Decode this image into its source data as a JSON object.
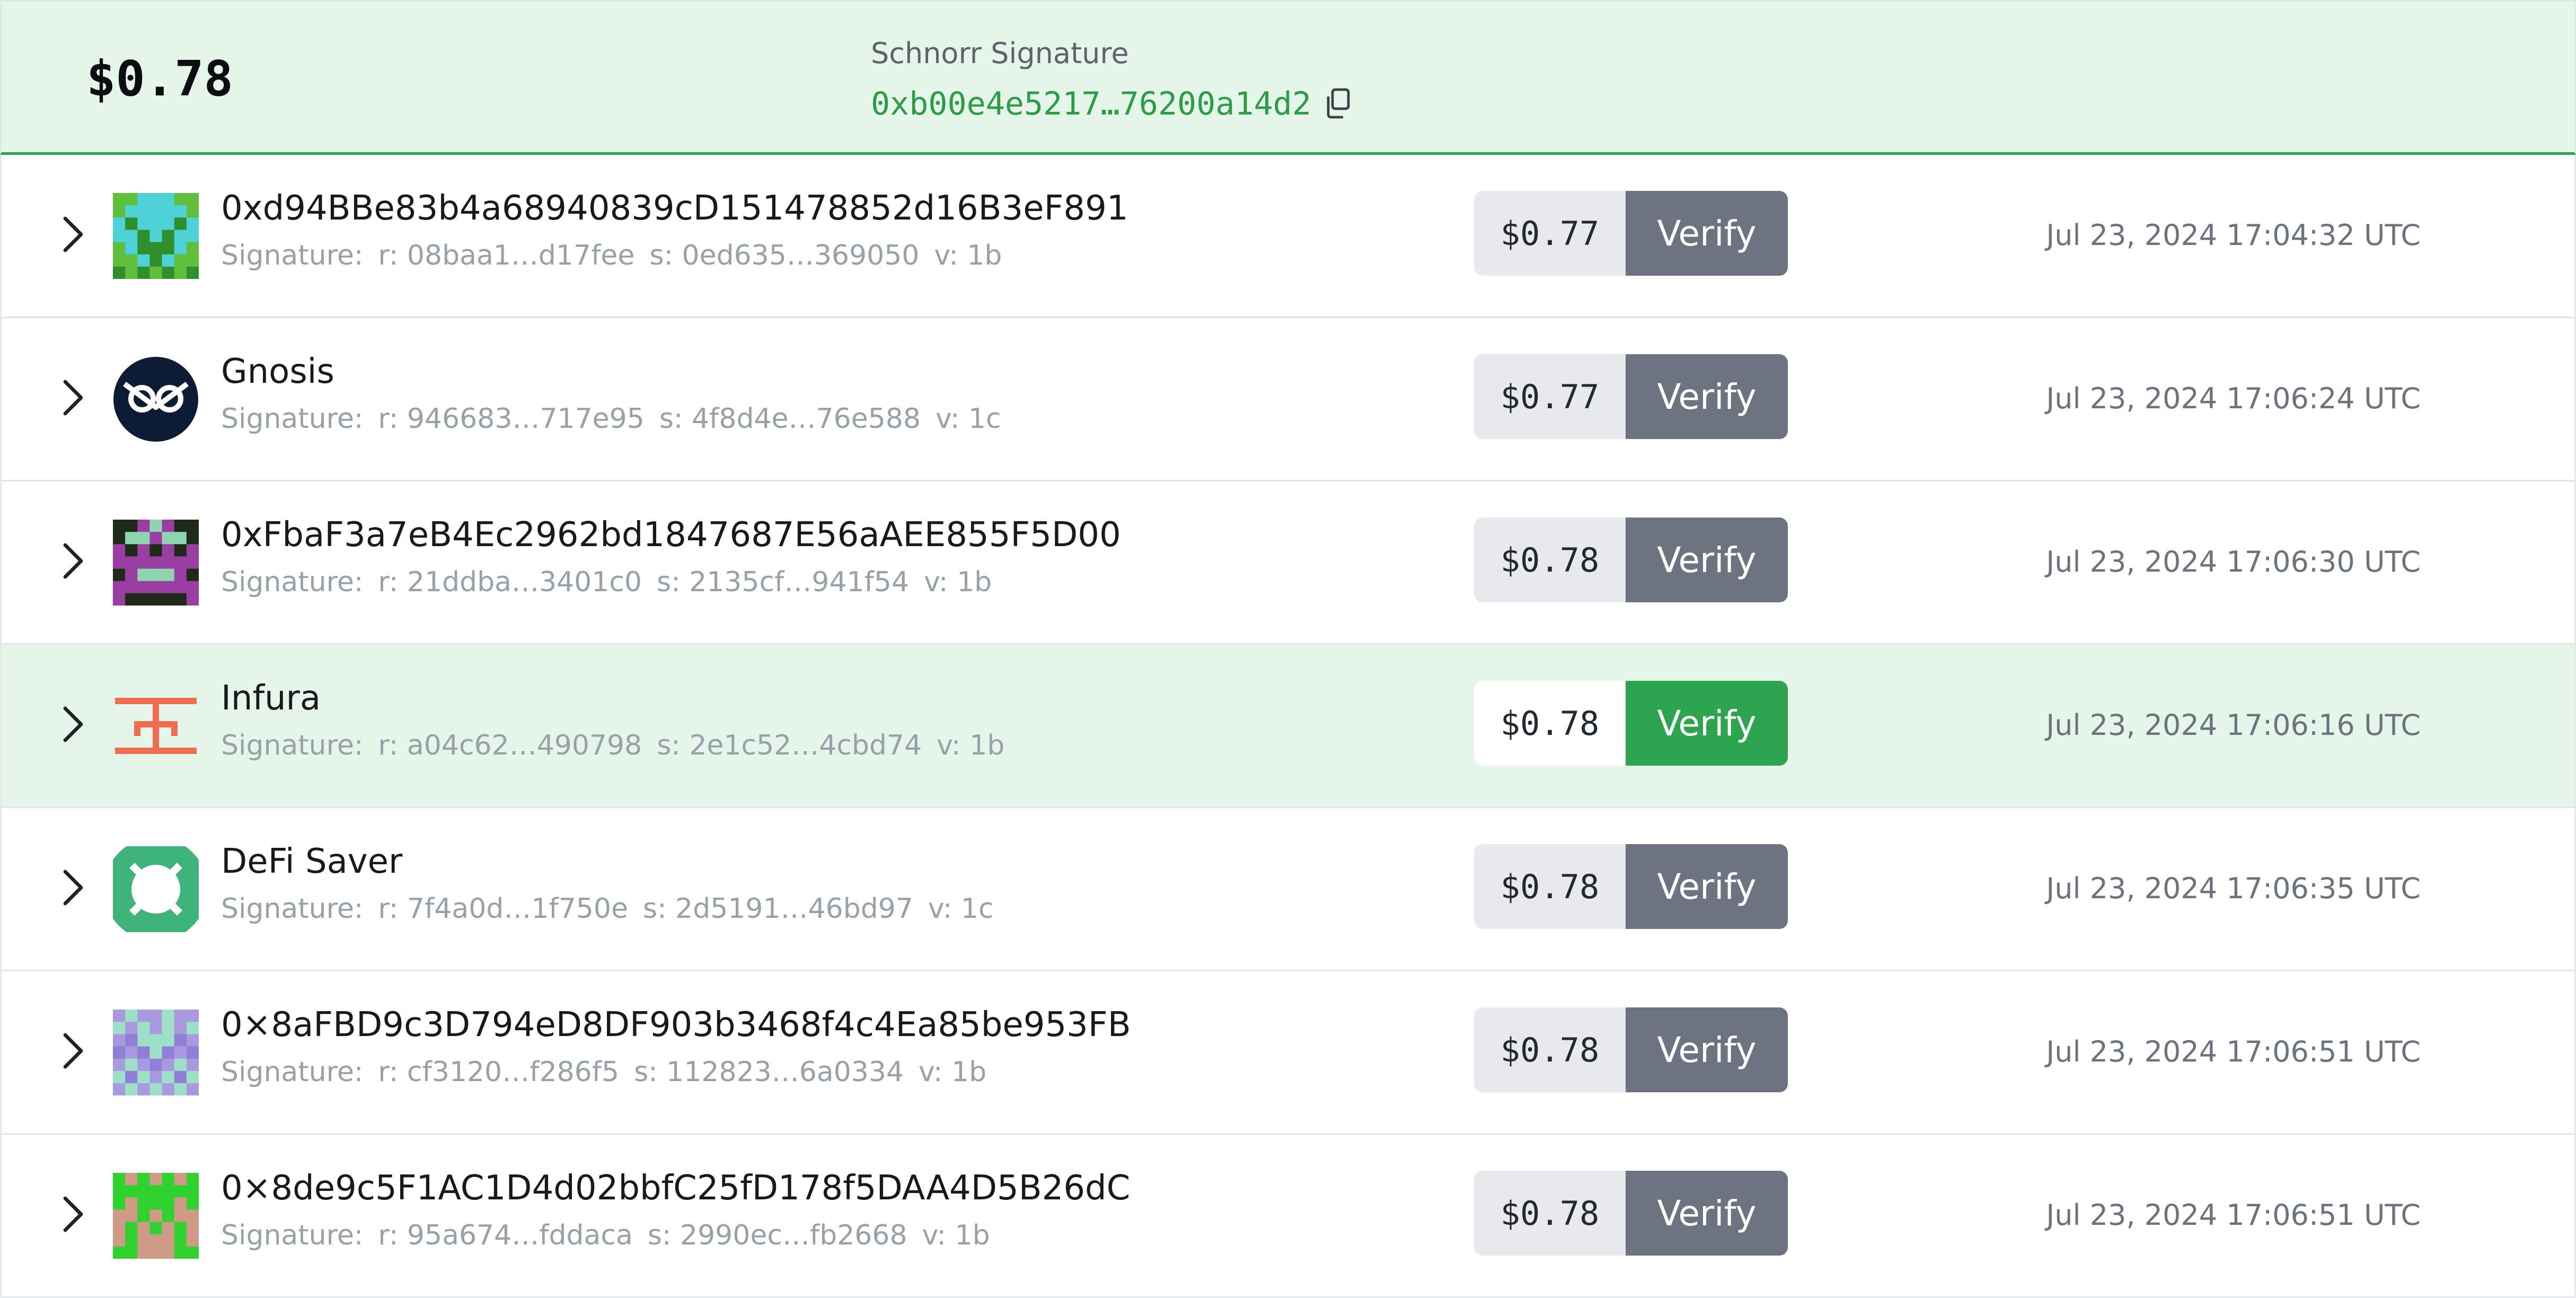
{
  "header": {
    "aggregate_price": "$0.78",
    "signature_label": "Schnorr Signature",
    "signature_value": "0xb00e4e5217…76200a14d2"
  },
  "signature_prefix": "Signature:",
  "verify_label": "Verify",
  "rows": [
    {
      "name": "0xd94BBe83b4a68940839cD151478852d16B3eF891",
      "r": "r: 08baa1…d17fee",
      "s": "s: 0ed635…369050",
      "v": "v: 1b",
      "price": "$0.77",
      "time": "Jul 23, 2024 17:04:32 UTC",
      "highlighted": false,
      "avatar": "identicon-green-cyan"
    },
    {
      "name": "Gnosis",
      "r": "r: 946683…717e95",
      "s": "s: 4f8d4e…76e588",
      "v": "v: 1c",
      "price": "$0.77",
      "time": "Jul 23, 2024 17:06:24 UTC",
      "highlighted": false,
      "avatar": "gnosis-owl-logo"
    },
    {
      "name": "0xFbaF3a7eB4Ec2962bd1847687E56aAEE855F5D00",
      "r": "r: 21ddba…3401c0",
      "s": "s: 2135cf…941f54",
      "v": "v: 1b",
      "price": "$0.78",
      "time": "Jul 23, 2024 17:06:30 UTC",
      "highlighted": false,
      "avatar": "identicon-purple-dark"
    },
    {
      "name": "Infura",
      "r": "r: a04c62…490798",
      "s": "s: 2e1c52…4cbd74",
      "v": "v: 1b",
      "price": "$0.78",
      "time": "Jul 23, 2024 17:06:16 UTC",
      "highlighted": true,
      "avatar": "infura-logo"
    },
    {
      "name": "DeFi Saver",
      "r": "r: 7f4a0d…1f750e",
      "s": "s: 2d5191…46bd97",
      "v": "v: 1c",
      "price": "$0.78",
      "time": "Jul 23, 2024 17:06:35 UTC",
      "highlighted": false,
      "avatar": "defi-saver-lifebuoy-logo"
    },
    {
      "name": "0×8aFBD9c3D794eD8DF903b3468f4c4Ea85be953FB",
      "r": "r: cf3120…f286f5",
      "s": "s: 112823…6a0334",
      "v": "v: 1b",
      "price": "$0.78",
      "time": "Jul 23, 2024 17:06:51 UTC",
      "highlighted": false,
      "avatar": "identicon-lavender-mint"
    },
    {
      "name": "0×8de9c5F1AC1D4d02bbfC25fD178f5DAA4D5B26dC",
      "r": "r: 95a674…fddaca",
      "s": "s: 2990ec…fb2668",
      "v": "v: 1b",
      "price": "$0.78",
      "time": "Jul 23, 2024 17:06:51 UTC",
      "highlighted": false,
      "avatar": "identicon-green-pink"
    }
  ],
  "colors": {
    "accent_green": "#2da44e",
    "highlight_bg": "#e6f5ea",
    "verify_gray": "#6b7480"
  }
}
